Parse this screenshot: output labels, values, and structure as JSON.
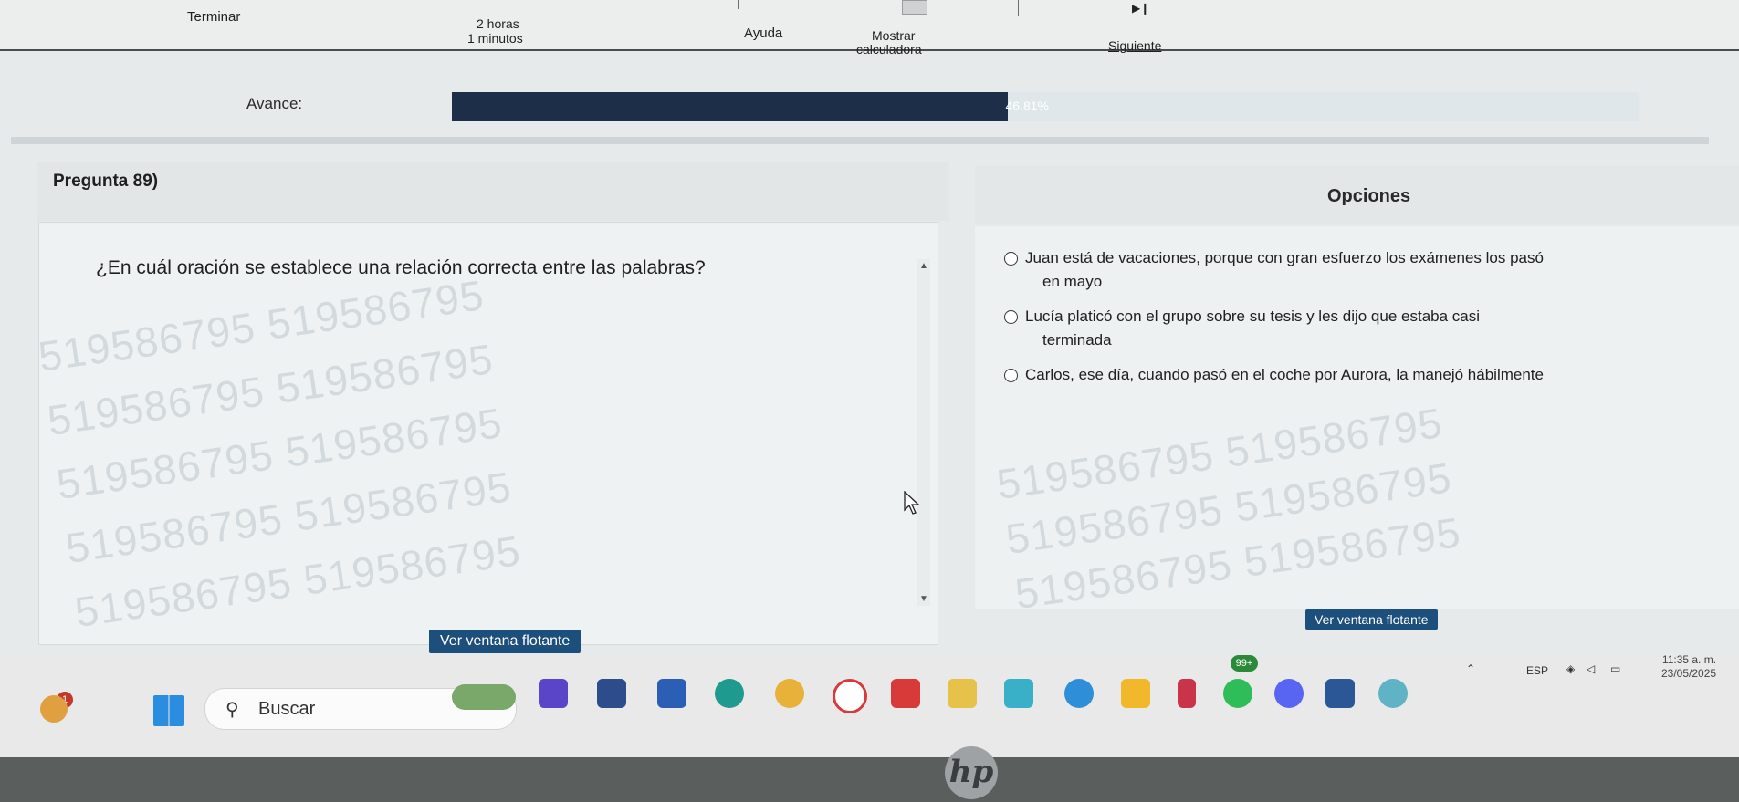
{
  "topbar": {
    "terminar": "Terminar",
    "time_hours": "2 horas",
    "time_minutes": "1 minutos",
    "ayuda": "Ayuda",
    "mostrar_line1": "Mostrar",
    "mostrar_line2": "calculadora",
    "siguiente": "Siguiente"
  },
  "progress": {
    "label": "Avance:",
    "value_text": "46.81%",
    "value": 46.81
  },
  "question": {
    "header": "Pregunta 89)",
    "text": "¿En cuál oración se establece una relación correcta entre las palabras?",
    "float_button": "Ver ventana flotante"
  },
  "options": {
    "header": "Opciones",
    "items": [
      {
        "line1": "Juan está de vacaciones, porque con gran esfuerzo los exámenes los pasó",
        "line2": "en mayo"
      },
      {
        "line1": "Lucía platicó con el grupo sobre su tesis y les dijo que estaba casi",
        "line2": "terminada"
      },
      {
        "line1": "Carlos, ese día, cuando pasó en el coche por Aurora, la manejó hábilmente",
        "line2": ""
      }
    ],
    "float_button": "Ver ventana flotante"
  },
  "watermark": "519586795 519586795",
  "taskbar": {
    "search_label": "Buscar",
    "notification_count": "1",
    "badge_count": "99+",
    "language": "ESP",
    "time": "11:35 a. m.",
    "date": "23/05/2025",
    "app_icons": [
      "widgets-icon",
      "windows-start-icon",
      "search-icon",
      "turtle-app-icon",
      "dev-app-icon",
      "file-icon",
      "video-icon",
      "chat-icon",
      "chrome-icon",
      "opera-icon",
      "youtube-icon",
      "calc-icon",
      "store-icon",
      "edge-icon",
      "folder-icon",
      "media-icon",
      "whatsapp-icon",
      "discord-icon",
      "word-icon",
      "vpn-icon"
    ]
  },
  "device_logo": "hp"
}
